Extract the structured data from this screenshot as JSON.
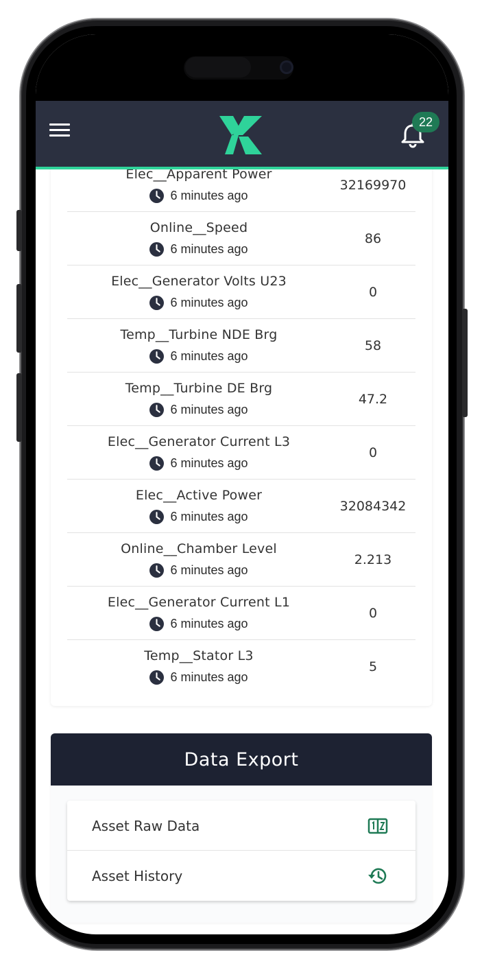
{
  "header": {
    "notification_count": "22",
    "accent_color": "#2fd39a",
    "background_color": "#2b3040",
    "menu_icon": "menu-icon",
    "bell_icon": "bell-icon"
  },
  "readings": [
    {
      "name": "Elec__Apparent Power",
      "time": "6 minutes ago",
      "value": "32169970"
    },
    {
      "name": "Online__Speed",
      "time": "6 minutes ago",
      "value": "86"
    },
    {
      "name": "Elec__Generator Volts U23",
      "time": "6 minutes ago",
      "value": "0"
    },
    {
      "name": "Temp__Turbine NDE Brg",
      "time": "6 minutes ago",
      "value": "58"
    },
    {
      "name": "Temp__Turbine DE Brg",
      "time": "6 minutes ago",
      "value": "47.2"
    },
    {
      "name": "Elec__Generator Current L3",
      "time": "6 minutes ago",
      "value": "0"
    },
    {
      "name": "Elec__Active Power",
      "time": "6 minutes ago",
      "value": "32084342"
    },
    {
      "name": "Online__Chamber Level",
      "time": "6 minutes ago",
      "value": "2.213"
    },
    {
      "name": "Elec__Generator Current L1",
      "time": "6 minutes ago",
      "value": "0"
    },
    {
      "name": "Temp__Stator L3",
      "time": "6 minutes ago",
      "value": "5"
    }
  ],
  "data_export": {
    "title": "Data Export",
    "items": [
      {
        "label": "Asset Raw Data",
        "icon": "raw-data-icon"
      },
      {
        "label": "Asset History",
        "icon": "history-icon"
      }
    ],
    "icon_color": "#1f7a55"
  }
}
